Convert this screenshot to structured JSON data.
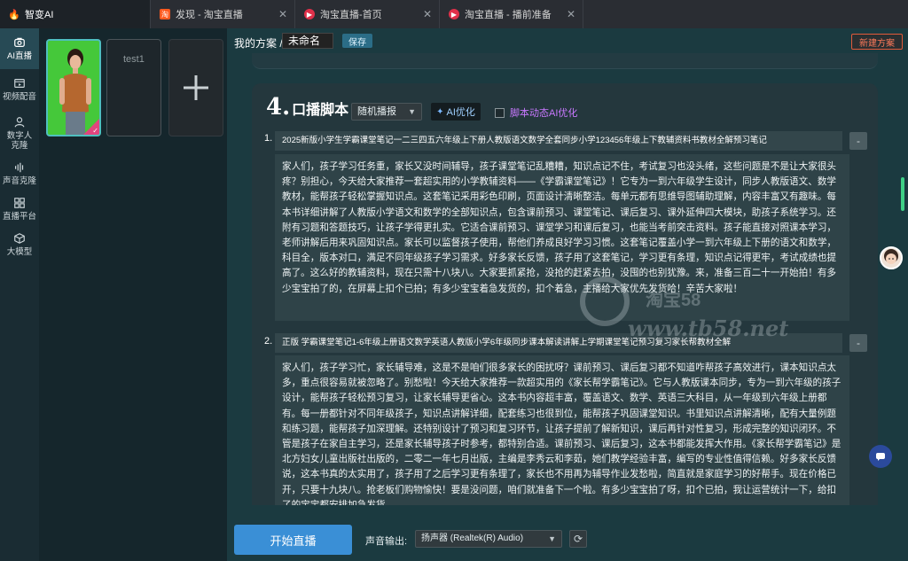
{
  "tabs": [
    {
      "label": "智变AI",
      "active": true,
      "icon": "flame-icon",
      "color": "#ff4a6a"
    },
    {
      "label": "发现 - 淘宝直播",
      "active": false,
      "icon": "taobao-icon",
      "color": "#ff5a1f"
    },
    {
      "label": "淘宝直播-首页",
      "active": false,
      "icon": "live-icon",
      "color": "#e0304a"
    },
    {
      "label": "淘宝直播 - 播前准备",
      "active": false,
      "icon": "live-icon",
      "color": "#e0304a"
    }
  ],
  "sidebar": {
    "items": [
      {
        "label": "AI直播",
        "icon": "camera-icon",
        "active": true
      },
      {
        "label": "视频配音",
        "icon": "film-icon",
        "active": false
      },
      {
        "label": "数字人克隆",
        "icon": "person-icon",
        "active": false
      },
      {
        "label": "声音克隆",
        "icon": "waveform-icon",
        "active": false
      },
      {
        "label": "直播平台",
        "icon": "grid-icon",
        "active": false
      },
      {
        "label": "大模型",
        "icon": "cube-icon",
        "active": false
      }
    ]
  },
  "avatars": {
    "second_label": "test1",
    "add_symbol": "+"
  },
  "header": {
    "plan_label": "我的方案 /",
    "plan_name": "未命名",
    "save_label": "保存",
    "new_plan_label": "新建方案"
  },
  "script_section": {
    "number": "4.",
    "title": "口播脚本",
    "mode": "随机播报",
    "ai_optimize": "AI优化",
    "ai_dynamic": "脚本动态AI优化",
    "items": [
      {
        "num": "1.",
        "title": "2025新版小学生学霸课堂笔记一二三四五六年级上下册人教版语文数学全套同步小学123456年级上下教辅资料书教材全解预习笔记",
        "body": "家人们，孩子学习任务重，家长又没时间辅导，孩子课堂笔记乱糟糟，知识点记不住，考试复习也没头绪，这些问题是不是让大家很头疼？别担心，今天给大家推荐一套超实用的小学教辅资料——《学霸课堂笔记》！它专为一到六年级学生设计，同步人教版语文、数学教材，能帮孩子轻松掌握知识点。这套笔记采用彩色印刷，页面设计清晰整洁。每单元都有思维导图辅助理解，内容丰富又有趣味。每本书详细讲解了人教版小学语文和数学的全部知识点，包含课前预习、课堂笔记、课后复习、课外延伸四大模块，助孩子系统学习。还附有习题和答题技巧，让孩子学得更扎实。它适合课前预习、课堂学习和课后复习，也能当考前突击资料。孩子能直接对照课本学习，老师讲解后用来巩固知识点。家长可以监督孩子使用，帮他们养成良好学习习惯。这套笔记覆盖小学一到六年级上下册的语文和数学，科目全，版本对口，满足不同年级孩子学习需求。好多家长反馈，孩子用了这套笔记，学习更有条理，知识点记得更牢，考试成绩也提高了。这么好的教辅资料，现在只需十八块八。大家要抓紧抢，没抢的赶紧去拍，没囤的也别犹豫。来，准备三百二十一开始拍！有多少宝宝拍了的，在屏幕上扣个已拍；有多少宝宝着急发货的，扣个着急，主播给大家优先发货哈！辛苦大家啦！"
      },
      {
        "num": "2.",
        "title": "正版 学霸课堂笔记1-6年级上册语文数学英语人教版小学6年级同步课本解读讲解上学期课堂笔记预习复习家长帮教材全解",
        "body": "家人们，孩子学习忙，家长辅导难，这是不是咱们很多家长的困扰呀？课前预习、课后复习都不知道咋帮孩子高效进行，课本知识点太多，重点很容易就被忽略了。别愁啦！今天给大家推荐一款超实用的《家长帮学霸笔记》。它与人教版课本同步，专为一到六年级的孩子设计，能帮孩子轻松预习复习，让家长辅导更省心。这本书内容超丰富，覆盖语文、数学、英语三大科目，从一年级到六年级上册都有。每一册都针对不同年级孩子，知识点讲解详细，配套练习也很到位，能帮孩子巩固课堂知识。书里知识点讲解清晰，配有大量例题和练习题，能帮孩子加深理解。还特别设计了预习和复习环节，让孩子提前了解新知识，课后再针对性复习，形成完整的知识闭环。不管是孩子在家自主学习，还是家长辅导孩子时参考，都特别合适。课前预习、课后复习，这本书都能发挥大作用。《家长帮学霸笔记》是北方妇女儿童出版社出版的，二零二一年七月出版，主编是李秀云和李茹，她们教学经验丰富，编写的专业性值得信赖。好多家长反馈说，这本书真的太实用了，孩子用了之后学习更有条理了，家长也不用再为辅导作业发愁啦，简直就是家庭学习的好帮手。现在价格已开，只要十九块八。抢老板们购物愉快！要是没问题，咱们就准备下一个啦。有多少宝宝拍了呀，扣个已拍，我让运营统计一下，给扣了的宝宝都安排加急发货。"
      }
    ]
  },
  "watermark": {
    "site": "www.tb58.net",
    "brand": "淘宝58"
  },
  "bottom": {
    "start_label": "开始直播",
    "audio_label": "声音输出:",
    "audio_device": "扬声器 (Realtek(R) Audio)"
  },
  "colors": {
    "accent": "#3a8fd6",
    "active_sidebar": "#274a55",
    "new_plan": "#e05a3a",
    "ai_dynamic": "#c978ff"
  }
}
